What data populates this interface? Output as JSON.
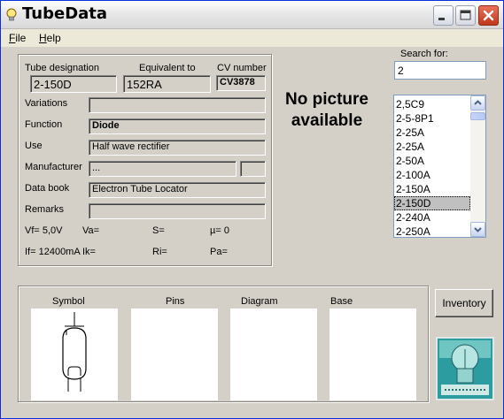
{
  "window": {
    "title": "TubeData"
  },
  "menu": {
    "file_label": "ile",
    "file_accel": "F",
    "help_label": "elp",
    "help_accel": "H"
  },
  "tube": {
    "designation_label": "Tube designation",
    "designation": "2-150D",
    "equivalent_label": "Equivalent to",
    "equivalent": "152RA",
    "cv_label": "CV number",
    "cv": "CV3878",
    "variations_label": "Variations",
    "variations": "",
    "function_label": "Function",
    "function": "Diode",
    "use_label": "Use",
    "use": "Half wave rectifier",
    "manufacturer_label": "Manufacturer",
    "manufacturer": "...",
    "manufacturer_code": "",
    "databook_label": "Data book",
    "databook": "Electron Tube Locator",
    "remarks_label": "Remarks",
    "remarks": ""
  },
  "params": {
    "vf": "Vf= 5,0V",
    "va": "Va=",
    "s": "S=",
    "mu": "µ=   0",
    "if": "If= 12400mA",
    "ik": "Ik=",
    "ri": "Ri=",
    "pa": "Pa="
  },
  "picture": {
    "placeholder": "No picture available"
  },
  "search": {
    "label": "Search for:",
    "value": "2"
  },
  "tube_list": {
    "items": [
      "2,5C9",
      "2-5-8P1",
      "2-25A",
      "2-25A",
      "2-50A",
      "2-100A",
      "2-150A",
      "2-150D",
      "2-240A",
      "2-250A"
    ],
    "selected": "2-150D"
  },
  "panels": {
    "symbol": "Symbol",
    "pins": "Pins",
    "diagram": "Diagram",
    "base": "Base"
  },
  "buttons": {
    "inventory": "Inventory"
  },
  "colors": {
    "window_border": "#0831d9",
    "close_button": "#c1381c",
    "list_selection": "#c0c0c0"
  }
}
